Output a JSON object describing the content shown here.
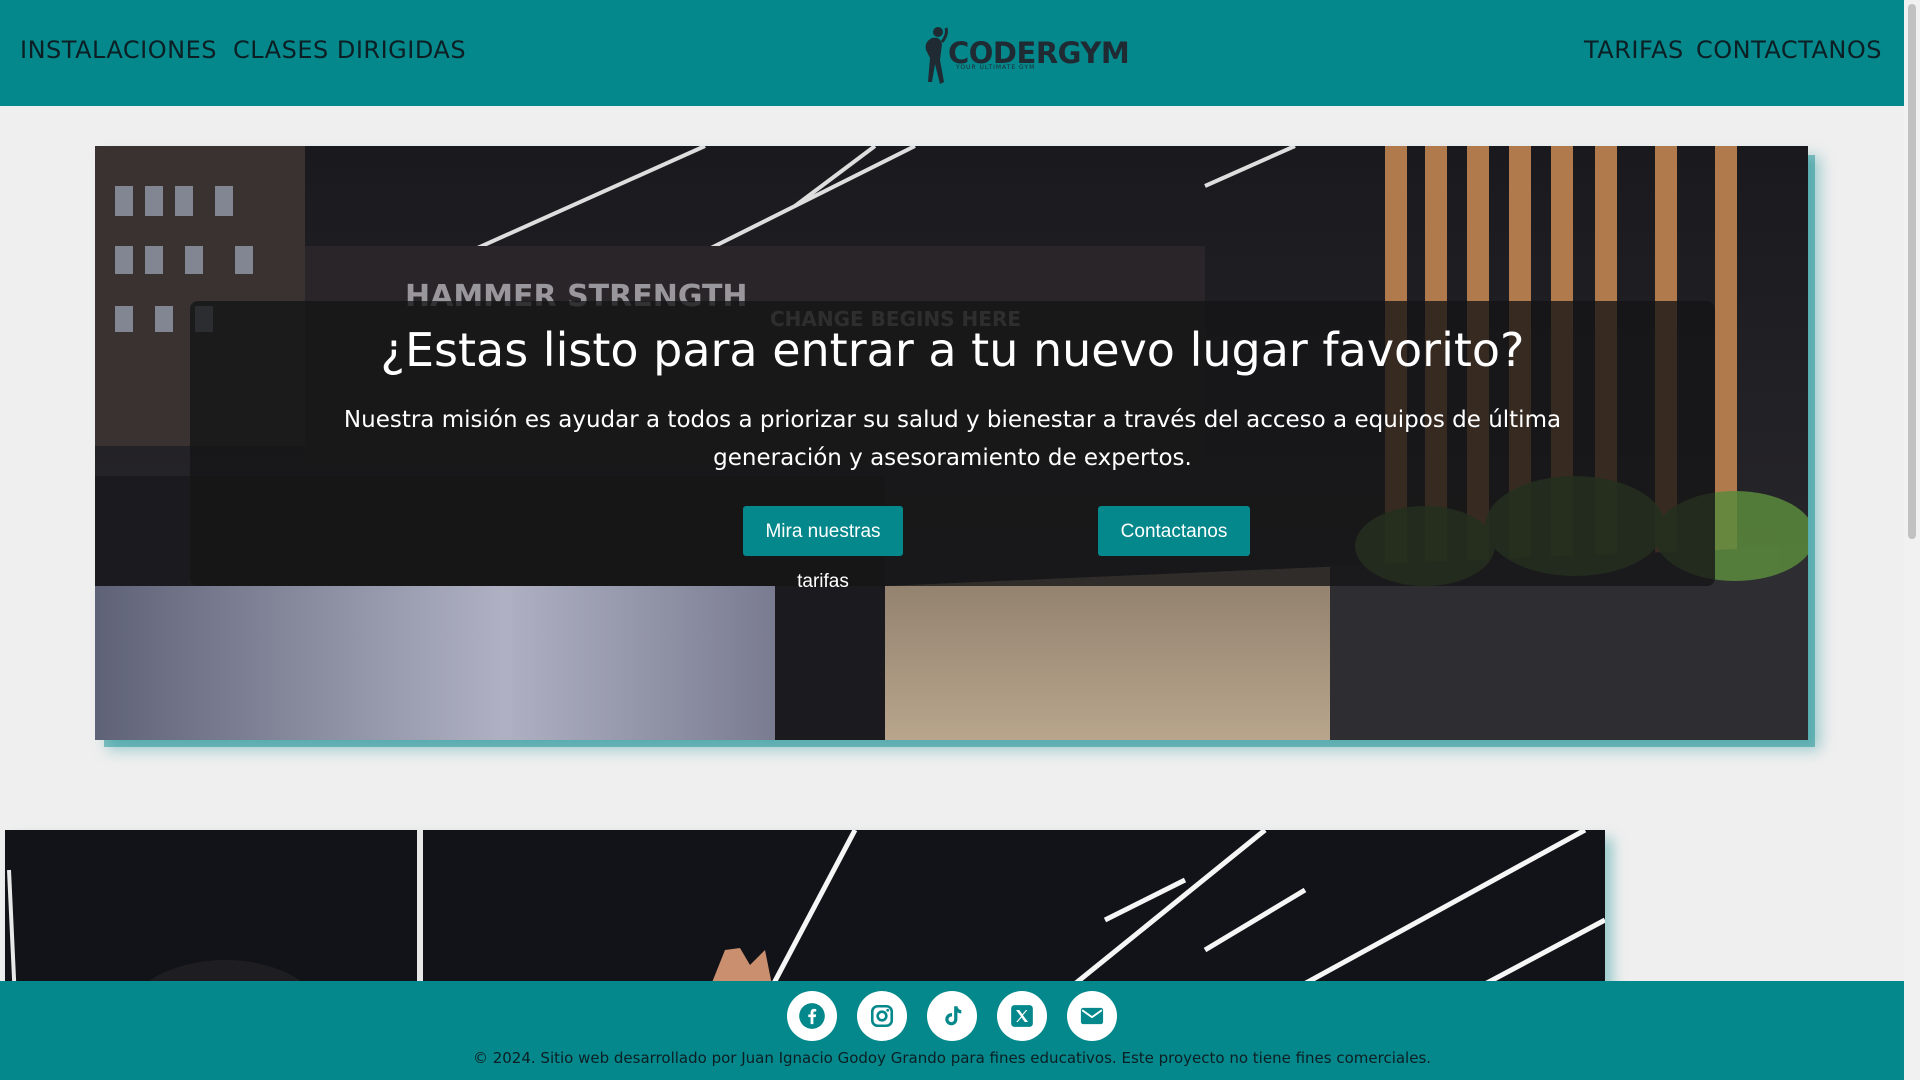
{
  "nav": {
    "left": [
      "INSTALACIONES",
      "CLASES DIRIGIDAS"
    ],
    "right": [
      "TARIFAS",
      "CONTACTANOS"
    ]
  },
  "logo": {
    "title": "CODERGYM",
    "subtitle": "YOUR ULTIMATE GYM"
  },
  "hero": {
    "title": "¿Estas listo para entrar a tu nuevo lugar favorito?",
    "text": "Nuestra misión es ayudar a todos a priorizar su salud y bienestar a través del acceso a equipos de última generación y asesoramiento de expertos.",
    "buttons": [
      "Mira nuestras tarifas",
      "Contactanos"
    ],
    "background_words": [
      "HAMMER STRENGTH",
      "CHANGE BEGINS HERE"
    ]
  },
  "footer": {
    "social_icons": [
      "facebook-icon",
      "instagram-icon",
      "tiktok-icon",
      "x-icon",
      "email-icon"
    ],
    "copyright": "© 2024. Sitio web desarrollado por Juan Ignacio Godoy Grando para fines educativos. Este proyecto no tiene fines comerciales."
  },
  "colors": {
    "brand": "#04888b",
    "text_dark": "#0b1f24",
    "page_bg": "#efefef"
  }
}
